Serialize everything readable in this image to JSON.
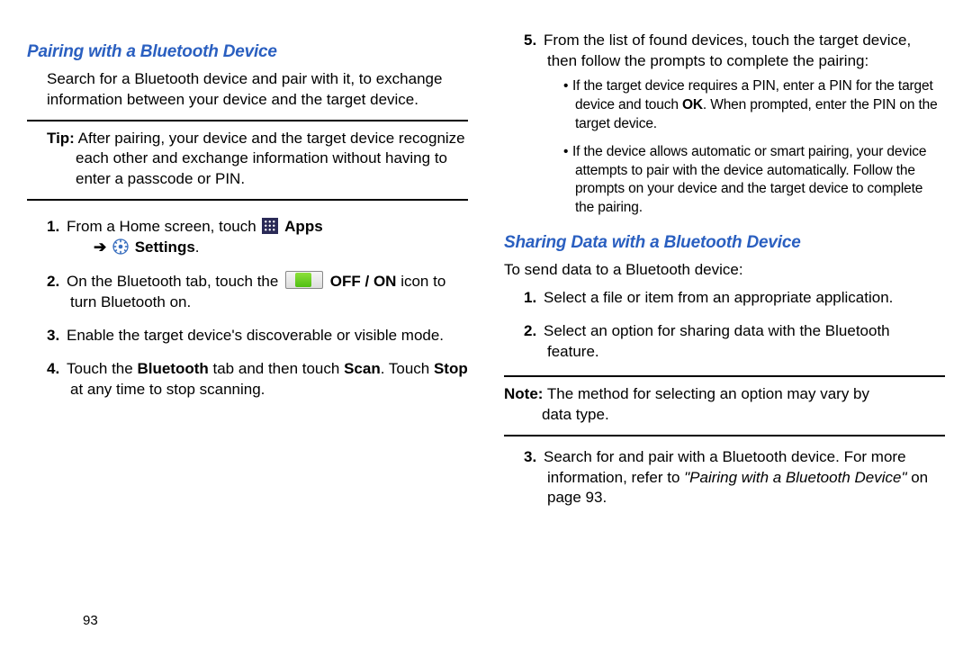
{
  "page_number": "93",
  "left": {
    "heading": "Pairing with a Bluetooth Device",
    "intro": "Search for a Bluetooth device and pair with it, to exchange information between your device and the target device.",
    "tip_label": "Tip:",
    "tip_body_1": "After pairing, your device and the target device recognize",
    "tip_body_2": "each other and exchange information without having to enter a passcode or PIN.",
    "step1_a": "From a Home screen, touch ",
    "step1_apps": "Apps",
    "step1_arrow": "➔",
    "step1_settings": "Settings",
    "step1_period": ".",
    "step2_a": "On the Bluetooth tab, touch the ",
    "step2_b": "OFF / ON",
    "step2_c": " icon to turn Bluetooth on.",
    "step3": "Enable the target device's discoverable or visible mode.",
    "step4_a": "Touch the ",
    "step4_b": "Bluetooth",
    "step4_c": " tab and then touch ",
    "step4_d": "Scan",
    "step4_e": ". Touch ",
    "step4_f": "Stop",
    "step4_g": " at any time to stop scanning."
  },
  "right": {
    "step5_a": "From the list of found devices, touch the target device, then follow the prompts to complete the pairing:",
    "bullet1_a": "If the target device requires a PIN, enter a PIN for the target device and touch ",
    "bullet1_b": "OK",
    "bullet1_c": ". When prompted, enter the PIN on the target device.",
    "bullet2": "If the device allows automatic or smart pairing, your device attempts to pair with the device automatically. Follow the prompts on your device and the target device to complete the pairing.",
    "heading2": "Sharing Data with a Bluetooth Device",
    "intro2": "To send data to a Bluetooth device:",
    "s1": "Select a file or item from an appropriate application.",
    "s2": "Select an option for sharing data with the Bluetooth feature.",
    "note_label": "Note:",
    "note_body_1": "The method for selecting an option may vary by",
    "note_body_2": "data type.",
    "s3_a": "Search for and pair with a Bluetooth device. For more information, refer to ",
    "s3_b": "\"Pairing with a Bluetooth Device\"",
    "s3_c": " on page 93."
  }
}
